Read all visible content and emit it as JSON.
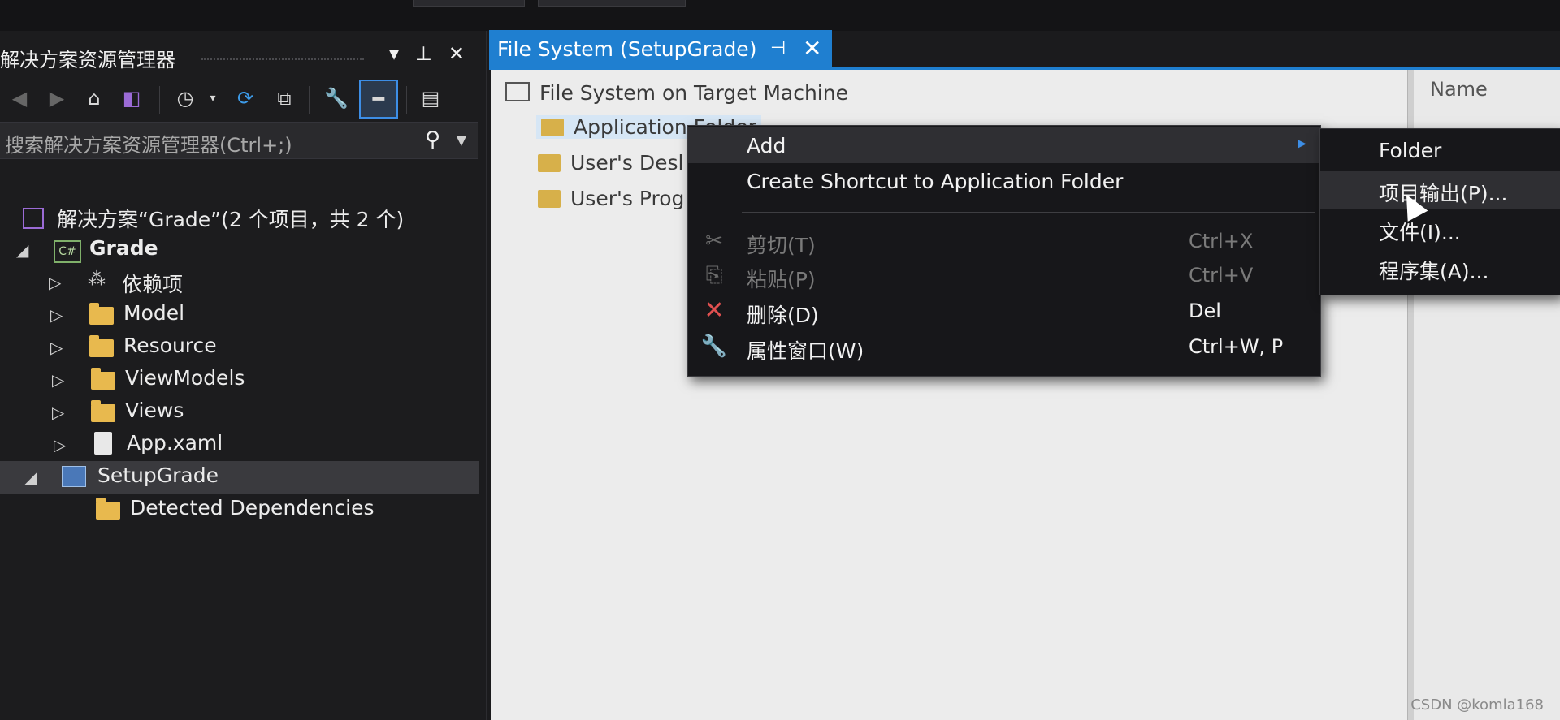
{
  "solution_explorer": {
    "title": "解决方案资源管理器",
    "title_icons": [
      "▾",
      "⊥",
      "✕"
    ],
    "search_placeholder": "搜索解决方案资源管理器(Ctrl+;)",
    "tree": [
      {
        "label": "解决方案“Grade”(2 个项目，共 2 个)",
        "icon": "solution-icon"
      },
      {
        "label": "Grade",
        "icon": "csharp-project-icon",
        "expanded": true
      },
      {
        "label": "依赖项",
        "icon": "dependencies-icon"
      },
      {
        "label": "Model",
        "icon": "folder-icon"
      },
      {
        "label": "Resource",
        "icon": "folder-icon"
      },
      {
        "label": "ViewModels",
        "icon": "folder-icon"
      },
      {
        "label": "Views",
        "icon": "folder-icon"
      },
      {
        "label": "App.xaml",
        "icon": "xaml-file-icon"
      },
      {
        "label": "SetupGrade",
        "icon": "setup-project-icon",
        "expanded": true,
        "selected": true
      },
      {
        "label": "Detected Dependencies",
        "icon": "folder-icon"
      }
    ]
  },
  "document_tab": {
    "label": "File System (SetupGrade)"
  },
  "file_system": {
    "root": "File System on Target Machine",
    "items": [
      "Application Folder",
      "User's Desktop",
      "User's Programs Menu"
    ],
    "visible_items": [
      "Application Folder",
      "User's Desl",
      "User's Prog"
    ],
    "right_header": "Name"
  },
  "context_menu": {
    "items": [
      {
        "label": "Add",
        "shortcut": "",
        "disabled": false,
        "submenu": true
      },
      {
        "label": "Create Shortcut to Application Folder",
        "shortcut": "",
        "disabled": false
      },
      {
        "label": "剪切(T)",
        "shortcut": "Ctrl+X",
        "disabled": true,
        "icon": "scissors-icon"
      },
      {
        "label": "粘贴(P)",
        "shortcut": "Ctrl+V",
        "disabled": true,
        "icon": "clipboard-icon"
      },
      {
        "label": "删除(D)",
        "shortcut": "Del",
        "disabled": false,
        "icon": "delete-icon"
      },
      {
        "label": "属性窗口(W)",
        "shortcut": "Ctrl+W, P",
        "disabled": false,
        "icon": "wrench-icon"
      }
    ]
  },
  "submenu": {
    "items": [
      "Folder",
      "项目输出(P)...",
      "文件(I)...",
      "程序集(A)..."
    ]
  },
  "watermark": "CSDN @komla168",
  "colors": {
    "accent": "#1f7fd0",
    "folder": "#e8b94e",
    "delete": "#e05050"
  }
}
